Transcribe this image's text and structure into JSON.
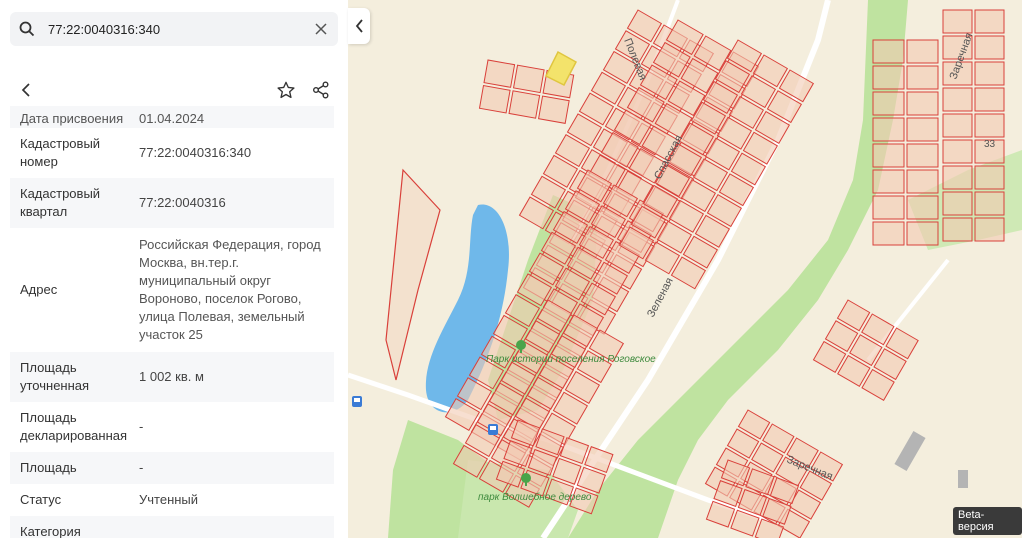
{
  "search": {
    "value": "77:22:0040316:340",
    "placeholder": ""
  },
  "properties": [
    {
      "label": "Дата присвоения",
      "value": "01.04.2024"
    },
    {
      "label": "Кадастровый номер",
      "value": "77:22:0040316:340"
    },
    {
      "label": "Кадастровый квартал",
      "value": "77:22:0040316"
    },
    {
      "label": "Адрес",
      "value": "Российская Федерация, город Москва, вн.тер.г. муниципальный округ Вороново, поселок Рогово, улица Полевая, земельный участок 25"
    },
    {
      "label": "Площадь уточненная",
      "value": "1 002 кв. м"
    },
    {
      "label": "Площадь декларированная",
      "value": "-"
    },
    {
      "label": "Площадь",
      "value": "-"
    },
    {
      "label": "Статус",
      "value": "Учтенный"
    },
    {
      "label": "Категория",
      "value": ""
    }
  ],
  "map": {
    "streets": [
      "Полевая",
      "Спасская",
      "Зеленая",
      "Заречная",
      "Заречная"
    ],
    "parks": [
      "Парк истории поселения Роговское",
      "парк Волшебное дерево"
    ],
    "house_number": "33",
    "beta_label": "Beta-версия",
    "colors": {
      "parcel": "#d9403a",
      "parcel_fill": "#f2c9b3",
      "selected": "#f3e36b",
      "water": "#6fb8ea",
      "green": "#bfe3a0"
    }
  },
  "icons": {
    "search": "search-icon",
    "clear": "close-icon",
    "back": "chevron-left-icon",
    "favorite": "star-icon",
    "share": "share-icon",
    "collapse": "chevron-left-icon"
  }
}
